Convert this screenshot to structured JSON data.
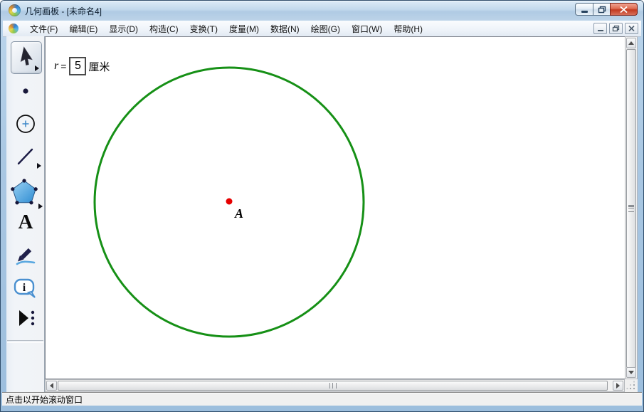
{
  "window": {
    "title": "几何画板 - [未命名4]"
  },
  "menu": {
    "items": [
      "文件(F)",
      "编辑(E)",
      "显示(D)",
      "构造(C)",
      "变换(T)",
      "度量(M)",
      "数据(N)",
      "绘图(G)",
      "窗口(W)",
      "帮助(H)"
    ]
  },
  "toolbar": {
    "tools": [
      {
        "name": "selection-arrow-tool",
        "selected": true
      },
      {
        "name": "point-tool"
      },
      {
        "name": "compass-circle-tool"
      },
      {
        "name": "segment-tool"
      },
      {
        "name": "polygon-tool"
      },
      {
        "name": "text-tool"
      },
      {
        "name": "marker-tool"
      },
      {
        "name": "information-tool"
      },
      {
        "name": "custom-tool"
      }
    ],
    "text_tool_glyph": "A",
    "info_tool_glyph": "i"
  },
  "document": {
    "radius_label": {
      "variable": "r",
      "equals": "=",
      "value": "5",
      "unit": "厘米"
    },
    "center_label": "A",
    "circle_color": "#169016",
    "point_color": "#e60000",
    "point_stroke": "#8f0000"
  },
  "status": {
    "text": "点击以开始滚动窗口"
  }
}
